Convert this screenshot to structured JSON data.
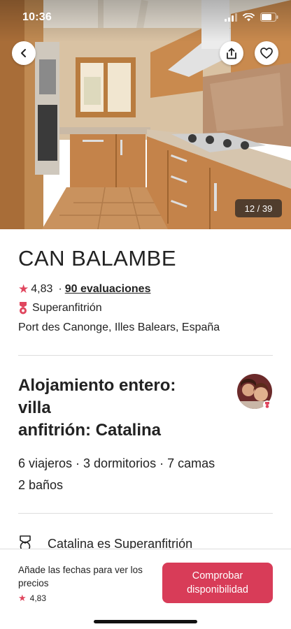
{
  "status_bar": {
    "time": "10:36"
  },
  "photo": {
    "counter": "12 / 39"
  },
  "listing": {
    "title": "CAN BALAMBE",
    "rating": "4,83",
    "separator": "·",
    "reviews": "90 evaluaciones",
    "superhost_label": "Superanfitrión",
    "location": "Port des Canonge, Illes Balears, España"
  },
  "lodging": {
    "title_line1": "Alojamiento entero:",
    "title_line2": "villa",
    "title_line3": "anfitrión: Catalina",
    "details_line1": "6 viajeros · 3 dormitorios · 7 camas",
    "details_line2": "2 baños"
  },
  "superhost_section": {
    "text": "Catalina es Superanfitrión"
  },
  "bottom_bar": {
    "price_note": "Añade las fechas para ver los precios",
    "rating": "4,83",
    "cta_label": "Comprobar disponibilidad"
  },
  "colors": {
    "accent": "#d83c58",
    "star": "#e0465e",
    "divider": "#dddddd"
  },
  "icons": [
    "back-arrow-icon",
    "share-icon",
    "heart-icon",
    "star-icon",
    "superhost-medal-icon",
    "signal-icon",
    "wifi-icon",
    "battery-icon"
  ]
}
